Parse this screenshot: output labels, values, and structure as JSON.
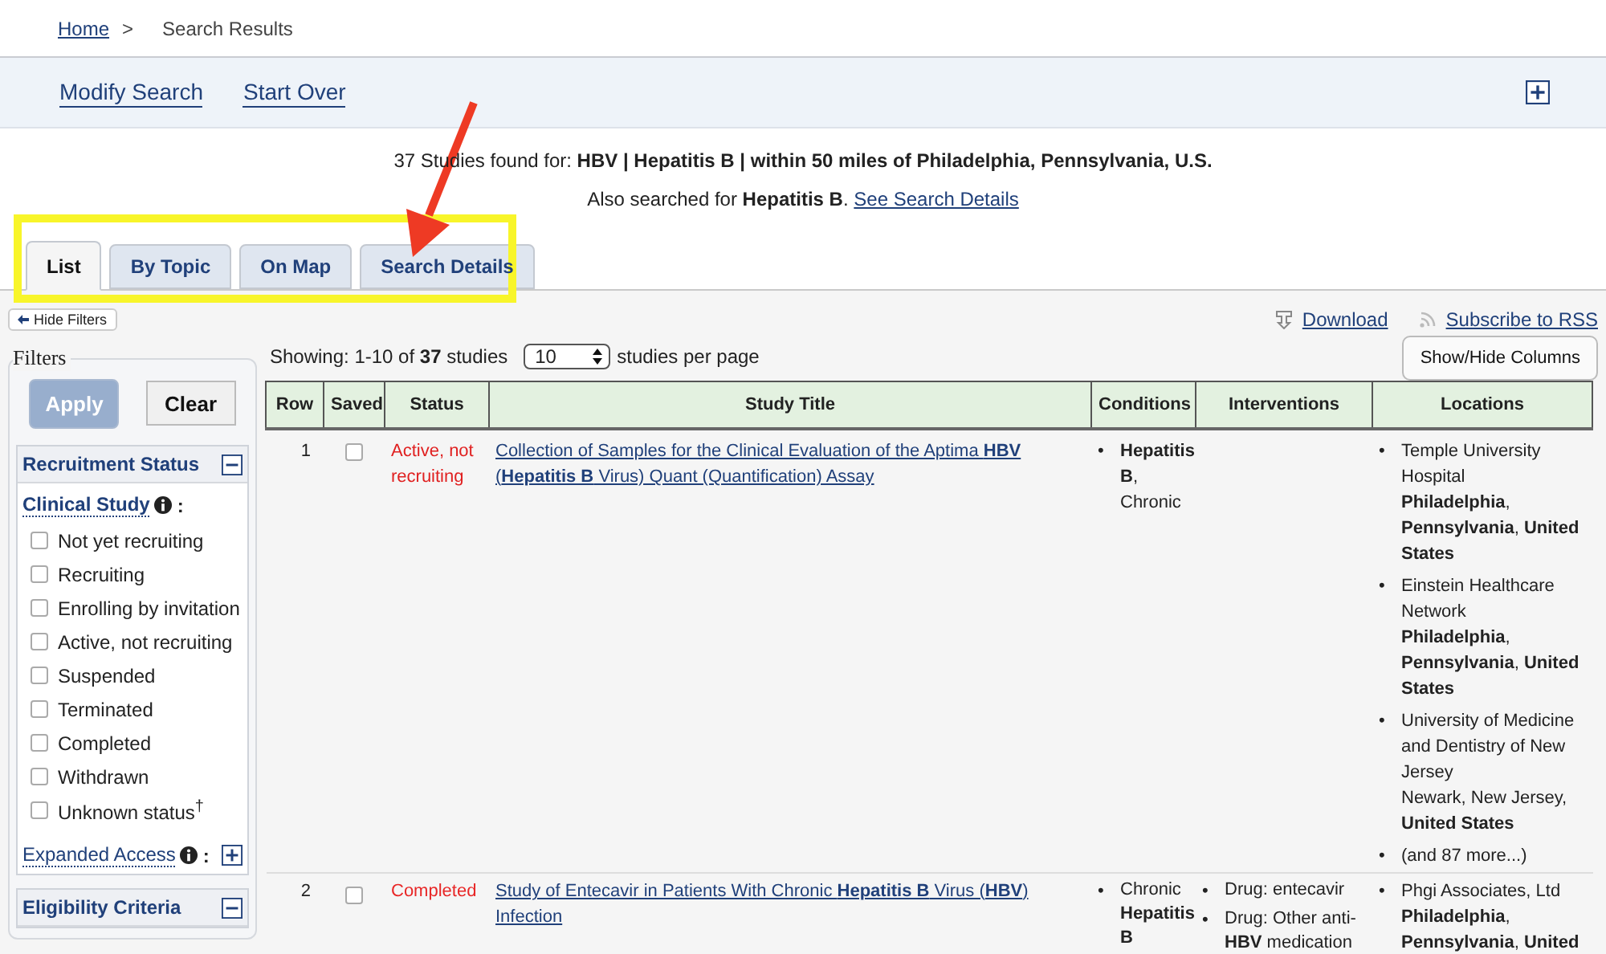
{
  "breadcrumb": {
    "home": "Home",
    "separator": ">",
    "current": "Search Results"
  },
  "header_links": [
    "Modify Search",
    "Start Over"
  ],
  "summary": {
    "line": "37 Studies found for: **HBV | Hepatitis B | within 50 miles of Philadelphia, Pennsylvania, U.S.**",
    "also": "Also searched for **Hepatitis B**.",
    "details_link": "See Search Details"
  },
  "tabs": [
    {
      "label": "List",
      "selected": true
    },
    {
      "label": "By Topic",
      "selected": false
    },
    {
      "label": "On Map",
      "selected": false
    },
    {
      "label": "Search Details",
      "selected": false
    }
  ],
  "hide_filters": "Hide Filters",
  "actions": [
    "Download",
    "Subscribe to RSS"
  ],
  "filters": {
    "legend": "Filters",
    "apply": {
      "label": "Apply",
      "disabled": true
    },
    "clear": "Clear",
    "section": "Recruitment Status",
    "group": "Clinical Study",
    "group_suffix": ":",
    "statuses": [
      {
        "label": "Not yet recruiting",
        "checked": false
      },
      {
        "label": "Recruiting",
        "checked": false
      },
      {
        "label": "Enrolling by invitation",
        "checked": false
      },
      {
        "label": "Active, not recruiting",
        "checked": false
      },
      {
        "label": "Suspended",
        "checked": false
      },
      {
        "label": "Terminated",
        "checked": false
      },
      {
        "label": "Completed",
        "checked": false
      },
      {
        "label": "Withdrawn",
        "checked": false
      },
      {
        "label": "Unknown status$^{†}$",
        "checked": false
      }
    ],
    "expanded_access": "Expanded Access",
    "expanded_access_suffix": ":",
    "next_section": "Eligibility Criteria"
  },
  "paging": {
    "showing": "Showing: 1-10 of **37** studies",
    "per_page": "10",
    "per_page_label": "studies per page"
  },
  "show_hide": "Show/Hide Columns",
  "bullet": "•",
  "table": {
    "columns": [
      "Row",
      "Saved",
      "Status",
      "Study Title",
      "Conditions",
      "Interventions",
      "Locations"
    ],
    "rows": [
      {
        "row": "1",
        "saved": false,
        "status": "Active, not recruiting",
        "title": "Collection of Samples for the Clinical Evaluation of the Aptima **HBV** (**Hepatitis B** Virus) Quant (Quantification) Assay",
        "conditions": [
          "**Hepatitis B**, Chronic"
        ],
        "interventions": [],
        "locations": [
          {
            "name": "Temple University Hospital",
            "place": "**Philadelphia**, **Pennsylvania**, **United States**"
          },
          {
            "name": "Einstein Healthcare Network",
            "place": "**Philadelphia**, **Pennsylvania**, **United States**"
          },
          {
            "name": "University of Medicine and Dentistry of New Jersey",
            "place": "Newark, New Jersey, **United States**"
          },
          {
            "name": "(and 87 more...)"
          }
        ]
      },
      {
        "row": "2",
        "saved": false,
        "status": "Completed",
        "title": "Study of Entecavir in Patients With Chronic **Hepatitis B** Virus (**HBV**) Infection",
        "conditions": [
          "Chronic **Hepatitis B**"
        ],
        "interventions": [
          "Drug: entecavir",
          "Drug: Other anti-**HBV** medication"
        ],
        "locations": [
          {
            "name": "Phgi Associates, Ltd",
            "place": "**Philadelphia**, **Pennsylvania**, **United**"
          }
        ]
      }
    ]
  },
  "annotations": [
    {
      "kind": "highlight-box"
    },
    {
      "kind": "arrow"
    }
  ]
}
